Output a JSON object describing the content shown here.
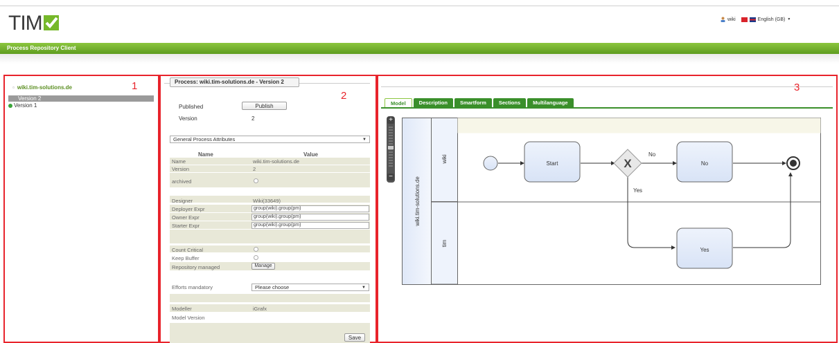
{
  "header": {
    "logo_text": "TIM",
    "user_label": "wiki",
    "language": "English (GB)",
    "dropdown_caret": "▼",
    "app_title": "Process Repository Client"
  },
  "colors": {
    "brand_green": "#76b82a",
    "tab_green": "#3a8f2a",
    "annotation_red": "#e8232b"
  },
  "annotations": [
    "1",
    "2",
    "3"
  ],
  "tree": {
    "root": "wiki.tim-solutions.de",
    "root_bullet": "▫",
    "items": [
      "Version 2",
      "Version 1"
    ]
  },
  "process": {
    "legend": "Process: wiki.tim-solutions.de - Version 2",
    "published_label": "Published",
    "publish_button": "Publish",
    "version_label": "Version",
    "version_value": "2",
    "section_select": "General Process Attributes",
    "col_name": "Name",
    "col_value": "Value",
    "attributes": {
      "name_label": "Name",
      "name_value": "wiki.tim-solutions.de",
      "version_label": "Version",
      "version_value": "2",
      "archived_label": "archived",
      "designer_label": "Designer",
      "designer_value": "Wiki(33649)",
      "deployer_label": "Deployer Expr",
      "deployer_value": "group(wiki).group(pm)",
      "owner_label": "Owner Expr",
      "owner_value": "group(wiki).group(pm)",
      "starter_label": "Starter Expr",
      "starter_value": "group(wiki).group(pm)",
      "count_critical_label": "Count Critical",
      "keep_buffer_label": "Keep Buffer",
      "repo_managed_label": "Repository managed",
      "manage_button": "Manage",
      "efforts_label": "Efforts mandatory",
      "efforts_select": "Please choose",
      "modeller_label": "Modeller",
      "modeller_value": "iGrafx",
      "model_version_label": "Model Version"
    },
    "save_button": "Save"
  },
  "model": {
    "tabs": [
      "Model",
      "Description",
      "Smartform",
      "Sections",
      "Multilanguage"
    ],
    "pool": "wiki.tim-solutions.de",
    "lanes": [
      "wiki",
      "tim"
    ],
    "tasks": {
      "start": "Start",
      "no": "No",
      "yes": "Yes"
    },
    "gateway_mark": "X",
    "edge_no": "No",
    "edge_yes": "Yes",
    "zoom_in": "+",
    "zoom_out": "−"
  }
}
